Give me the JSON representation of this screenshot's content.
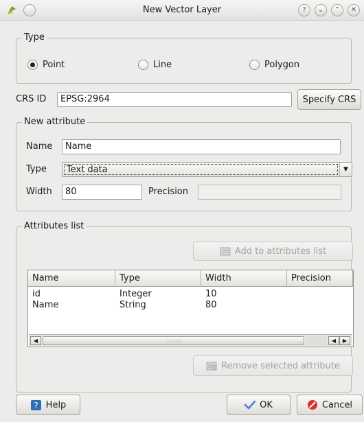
{
  "window": {
    "title": "New Vector Layer",
    "controls": [
      "help-icon",
      "minimize-icon",
      "maximize-icon",
      "close-icon"
    ]
  },
  "type_group": {
    "title": "Type",
    "options": [
      {
        "label": "Point",
        "selected": true
      },
      {
        "label": "Line",
        "selected": false
      },
      {
        "label": "Polygon",
        "selected": false
      }
    ]
  },
  "crs": {
    "label": "CRS ID",
    "value": "EPSG:2964",
    "button": "Specify CRS"
  },
  "new_attribute": {
    "title": "New attribute",
    "name_label": "Name",
    "name_value": "Name",
    "type_label": "Type",
    "type_value": "Text data",
    "width_label": "Width",
    "width_value": "80",
    "precision_label": "Precision",
    "precision_value": ""
  },
  "attributes_list": {
    "title": "Attributes list",
    "add_button": "Add to attributes list",
    "remove_button": "Remove selected attribute",
    "columns": [
      "Name",
      "Type",
      "Width",
      "Precision"
    ],
    "rows": [
      [
        "id",
        "Integer",
        "10",
        ""
      ],
      [
        "Name",
        "String",
        "80",
        ""
      ]
    ]
  },
  "footer": {
    "help": "Help",
    "ok": "OK",
    "cancel": "Cancel"
  },
  "colors": {
    "accent_ok": "#4a7fc4",
    "cancel_red": "#d6332b",
    "help_blue": "#2f6db5"
  }
}
